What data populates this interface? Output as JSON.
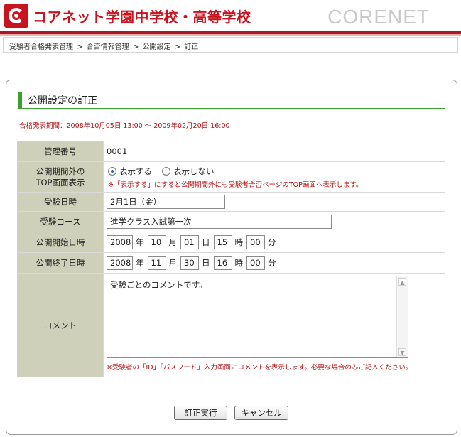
{
  "header": {
    "school_name": "コアネット学園中学校・高等学校",
    "brand": "CORENET",
    "accent_color": "#c8141e"
  },
  "breadcrumb": [
    "受験者合格発表管理",
    ">",
    "合否情報管理",
    ">",
    "公開設定",
    ">",
    "訂正"
  ],
  "page": {
    "title": "公開設定の訂正",
    "period": "合格発表期間：2008年10月05日 13:00 ～ 2009年02月20日 16:00"
  },
  "form": {
    "management_no": {
      "label": "管理番号",
      "value": "0001"
    },
    "top_display": {
      "label_line1": "公開期間外の",
      "label_line2": "TOP画面表示",
      "option_show": "表示する",
      "option_hide": "表示しない",
      "selected": "表示する",
      "note": "※「表示する」にすると公開期間外にも受験者合否ページのTOP画面へ表示します。"
    },
    "exam_date": {
      "label": "受験日時",
      "value": "2月1日（金）"
    },
    "exam_course": {
      "label": "受験コース",
      "value": "進学クラス入試第一次"
    },
    "publish_start": {
      "label": "公開開始日時",
      "year": "2008",
      "month": "10",
      "day": "01",
      "hour": "15",
      "minute": "00"
    },
    "publish_end": {
      "label": "公開終了日時",
      "year": "2008",
      "month": "11",
      "day": "30",
      "hour": "16",
      "minute": "00"
    },
    "units": {
      "year": "年",
      "month": "月",
      "day": "日",
      "hour": "時",
      "minute": "分"
    },
    "comment": {
      "label": "コメント",
      "value": "受験ごとのコメントです。",
      "note": "※受験者の「ID」「パスワード」入力画面にコメントを表示します。必要な場合のみご記入ください。"
    }
  },
  "buttons": {
    "submit": "訂正実行",
    "cancel": "キャンセル"
  }
}
